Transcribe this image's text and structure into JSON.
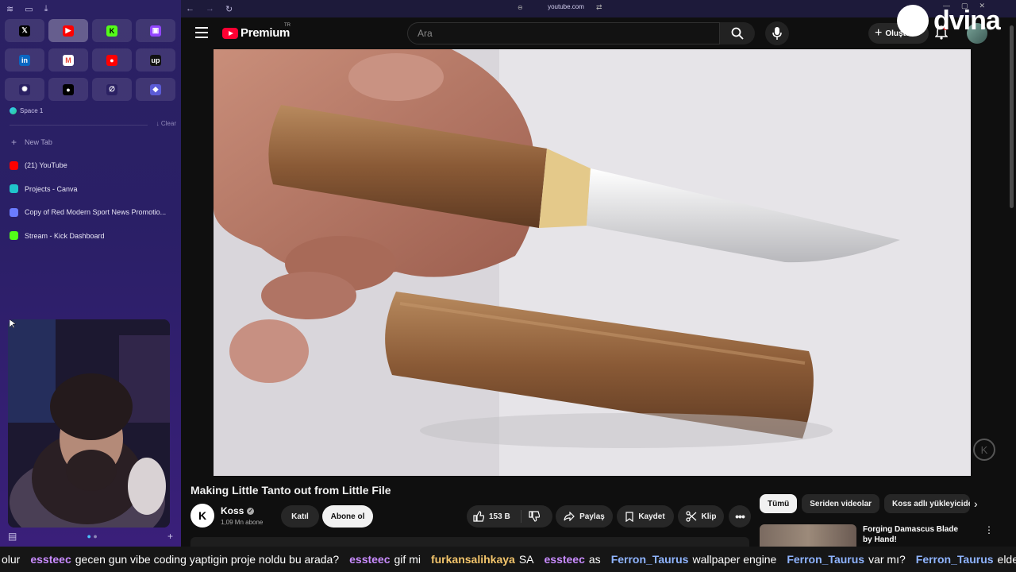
{
  "browser": {
    "url": "youtube.com",
    "pinned_tabs": [
      {
        "name": "x",
        "glyph": "𝕏",
        "bg": "#000000",
        "fg": "#ffffff"
      },
      {
        "name": "youtube",
        "glyph": "▶",
        "bg": "#ff0000",
        "fg": "#ffffff"
      },
      {
        "name": "kick",
        "glyph": "K",
        "bg": "#53fc18",
        "fg": "#000000"
      },
      {
        "name": "twitch",
        "glyph": "▣",
        "bg": "#9146ff",
        "fg": "#ffffff"
      },
      {
        "name": "linkedin",
        "glyph": "in",
        "bg": "#0a66c2",
        "fg": "#ffffff"
      },
      {
        "name": "gmail",
        "glyph": "M",
        "bg": "#ffffff",
        "fg": "#ea4335"
      },
      {
        "name": "youtube-music",
        "glyph": "●",
        "bg": "#ff0000",
        "fg": "#ffffff"
      },
      {
        "name": "upwork",
        "glyph": "up",
        "bg": "#111111",
        "fg": "#ffffff"
      },
      {
        "name": "chatgpt",
        "glyph": "✺",
        "bg": "#2b2163",
        "fg": "#ffffff"
      },
      {
        "name": "circle",
        "glyph": "●",
        "bg": "#000000",
        "fg": "#ffffff"
      },
      {
        "name": "perplexity",
        "glyph": "∅",
        "bg": "#2b2163",
        "fg": "#ffffff"
      },
      {
        "name": "linear",
        "glyph": "◆",
        "bg": "#5b5bd6",
        "fg": "#ffffff"
      }
    ],
    "space_label": "Space 1",
    "clear_label": "Clear",
    "new_tab_label": "New Tab",
    "tabs": [
      {
        "label": "(21) YouTube",
        "icon": "youtube-icon",
        "color": "#ff0000"
      },
      {
        "label": "Projects - Canva",
        "icon": "canva-icon",
        "color": "#20c4cb"
      },
      {
        "label": "Copy of Red Modern Sport News Promotio...",
        "icon": "canva-heart-icon",
        "color": "#6b7cff"
      },
      {
        "label": "Stream - Kick Dashboard",
        "icon": "kick-icon",
        "color": "#53fc18"
      }
    ]
  },
  "youtube": {
    "logo_text": "Premium",
    "country_code": "TR",
    "search_placeholder": "Ara",
    "create_label": "Oluştur",
    "video_title": "Making Little Tanto out from Little File",
    "channel_name": "Koss",
    "channel_initial": "K",
    "subscribers": "1,09 Mn abone",
    "join_label": "Katıl",
    "subscribe_label": "Abone ol",
    "likes": "153 B",
    "share_label": "Paylaş",
    "save_label": "Kaydet",
    "clip_label": "Klip",
    "chips": [
      "Tümü",
      "Seriden videolar",
      "Koss adlı yükleyiciden"
    ],
    "recommendation_title": "Forging Damascus Blade by Hand!",
    "accent": "#ff0033"
  },
  "watermark": "dvina",
  "chat": [
    {
      "user": "",
      "text": "olur",
      "color": "#ffffff"
    },
    {
      "user": "essteec",
      "text": "gecen gun vibe coding yaptigin proje noldu bu arada?",
      "color": "#c98cff"
    },
    {
      "user": "essteec",
      "text": "gif mi",
      "color": "#c98cff"
    },
    {
      "user": "furkansalihkaya",
      "text": "SA",
      "color": "#f2c46b"
    },
    {
      "user": "essteec",
      "text": "as",
      "color": "#c98cff"
    },
    {
      "user": "Ferron_Taurus",
      "text": "wallpaper engine",
      "color": "#8fb4ff"
    },
    {
      "user": "Ferron_Taurus",
      "text": "var mı?",
      "color": "#8fb4ff"
    },
    {
      "user": "Ferron_Taurus",
      "text": "elden ring?",
      "color": "#8fb4ff"
    }
  ]
}
